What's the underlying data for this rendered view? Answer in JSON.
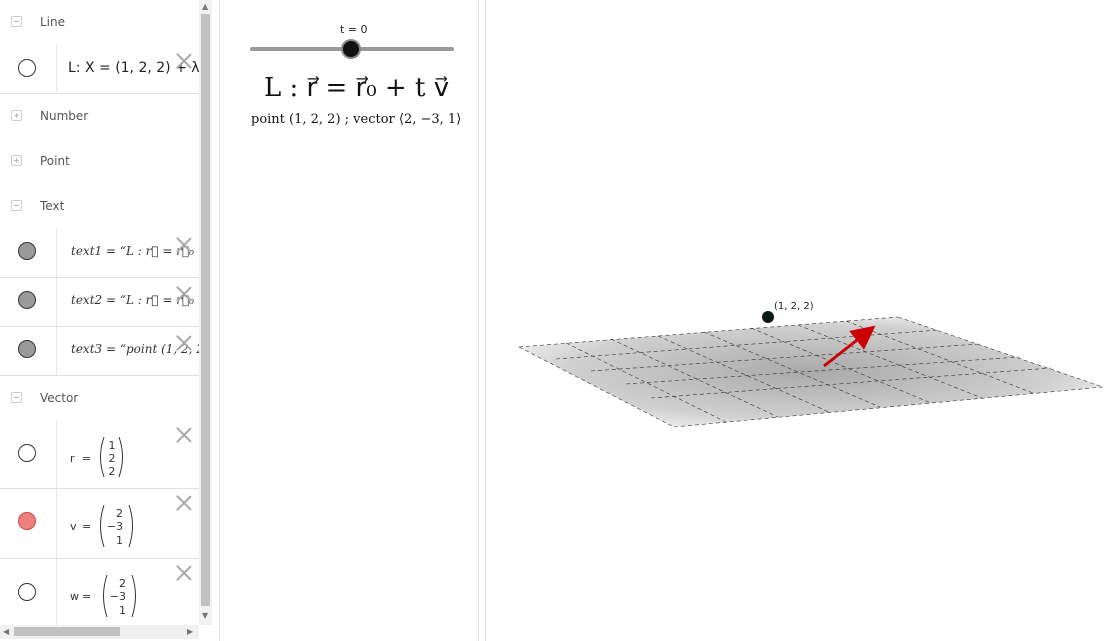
{
  "algebra": {
    "categories": {
      "line": "Line",
      "number": "Number",
      "point": "Point",
      "text": "Text",
      "vector": "Vector"
    },
    "line_row": {
      "definition": "L: X = (1, 2, 2) + λ ("
    },
    "text_rows": [
      {
        "content": "text1 = “L :  r⃗ = r⃗₀ +"
      },
      {
        "content": "text2 = “L :  r⃗ = r⃗₀ +"
      },
      {
        "content": "text3 = “point (1, 2, 2"
      }
    ],
    "vector_rows": [
      {
        "name": "r",
        "components": [
          "1",
          "2",
          "2"
        ],
        "color": "#ffffff"
      },
      {
        "name": "v",
        "components": [
          "2",
          "−3",
          "1"
        ],
        "color": "#f08080"
      },
      {
        "name": "w",
        "components": [
          "2",
          "−3",
          "1"
        ],
        "color": "#ffffff"
      }
    ],
    "marble_colors": {
      "line": "#ffffff",
      "text": "#999999"
    }
  },
  "graphics": {
    "slider": {
      "label": "t = 0",
      "value": 0
    },
    "equation": "L :  r⃗ = r⃗₀ + t v⃗",
    "description": "point (1, 2, 2) ;  vector ⟨2, −3, 1⟩"
  },
  "view3d": {
    "point_label": "(1, 2, 2)",
    "vector_color": "#cc0000"
  }
}
